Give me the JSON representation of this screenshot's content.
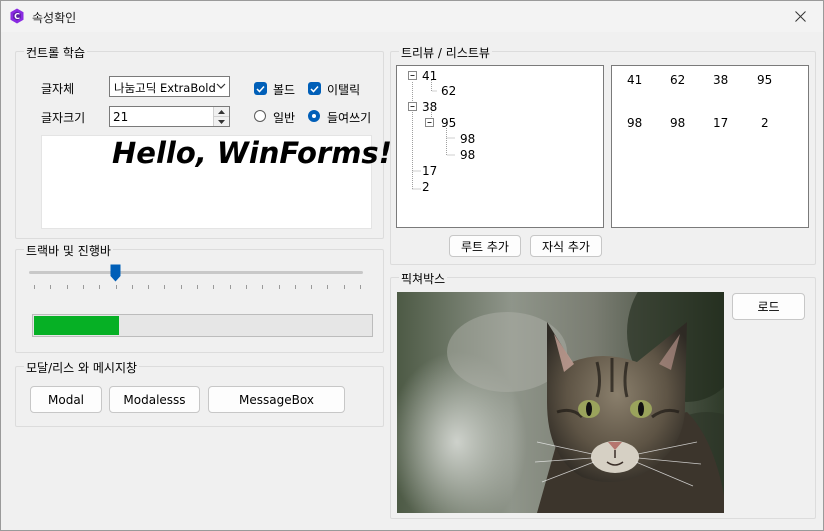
{
  "window": {
    "title": "속성확인"
  },
  "font_group": {
    "title": "컨트롤 학습",
    "font_label": "글자체",
    "font_value": "나눔고딕 ExtraBold",
    "size_label": "글자크기",
    "size_value": "21",
    "bold_label": "볼드",
    "bold_checked": true,
    "italic_label": "이탤릭",
    "italic_checked": true,
    "normal_label": "일반",
    "indent_label": "들여쓰기",
    "selected_radio": "들여쓰기",
    "preview_text": "Hello, WinForms!"
  },
  "slider_group": {
    "title": "트랙바 및 진행바",
    "trackbar_value": 0.25,
    "progress_value": 0.25
  },
  "modal_group": {
    "title": "모달/리스 와 메시지창",
    "modal_label": "Modal",
    "modaless_label": "Modalesss",
    "messagebox_label": "MessageBox"
  },
  "tree_group": {
    "title": "트리뷰 / 리스트뷰",
    "tree": [
      {
        "text": "41",
        "children": [
          {
            "text": "62"
          }
        ]
      },
      {
        "text": "38",
        "children": [
          {
            "text": "95",
            "children": [
              {
                "text": "98"
              },
              {
                "text": "98"
              }
            ]
          }
        ]
      },
      {
        "text": "17"
      },
      {
        "text": "2"
      }
    ],
    "list_rows": [
      [
        "41",
        "62",
        "38",
        "95"
      ],
      [
        "98",
        "98",
        "17",
        "2"
      ]
    ],
    "add_root_label": "루트 추가",
    "add_child_label": "자식 추가"
  },
  "picture_group": {
    "title": "픽쳐박스",
    "load_label": "로드"
  },
  "colors": {
    "accent": "#005fb8",
    "progress": "#06b025"
  }
}
